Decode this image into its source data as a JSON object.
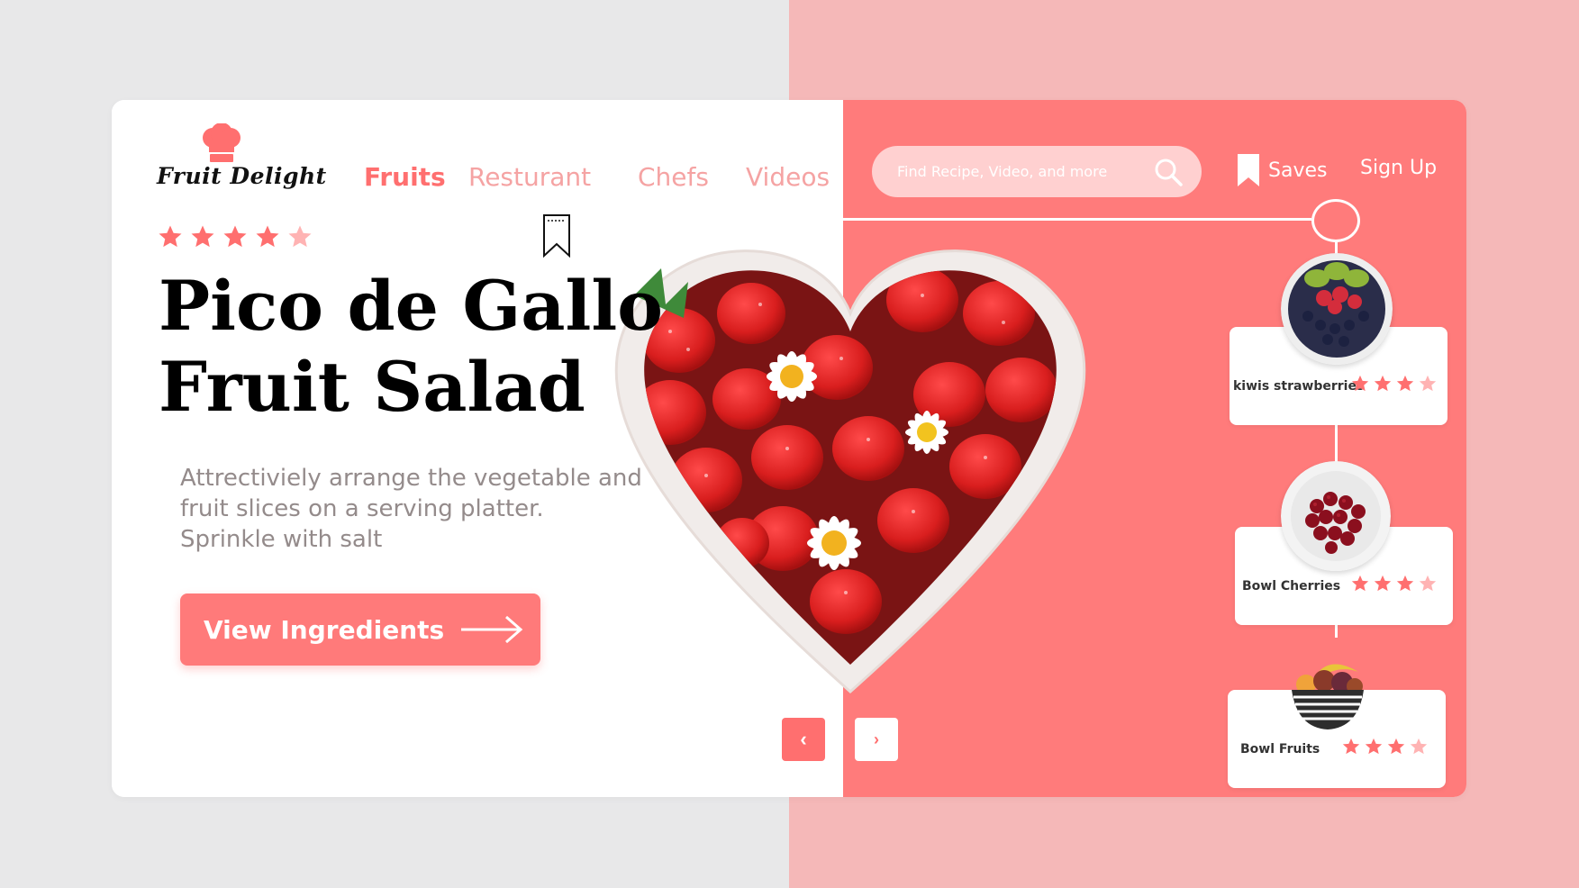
{
  "brand": {
    "name": "Fruit Delight",
    "icon": "chef-hat-icon",
    "color": "#ff6f6f"
  },
  "nav": [
    {
      "label": "Fruits",
      "active": true
    },
    {
      "label": "Resturant",
      "active": false
    },
    {
      "label": "Chefs",
      "active": false
    },
    {
      "label": "Videos",
      "active": false
    }
  ],
  "hero": {
    "rating": 4,
    "rating_max": 5,
    "title_line1": "Pico de Gallo",
    "title_line2": "Fruit Salad",
    "description": [
      "Attrectiviely arrange the vegetable and",
      "fruit slices on a serving platter.",
      "Sprinkle with salt"
    ],
    "cta_label": "View Ingredients"
  },
  "pager": {
    "prev_icon": "chevron-left-icon",
    "next_icon": "chevron-right-icon",
    "prev": "‹",
    "next": "›"
  },
  "search": {
    "placeholder": "Find Recipe, Video, and more",
    "value": ""
  },
  "header_actions": {
    "saves_label": "Saves",
    "signup_label": "Sign Up"
  },
  "recipes": [
    {
      "name": "kiwis strawberries",
      "rating": 3,
      "rating_max": 4
    },
    {
      "name": "Bowl Cherries",
      "rating": 3,
      "rating_max": 4
    },
    {
      "name": "Bowl Fruits",
      "rating": 3,
      "rating_max": 4
    }
  ],
  "colors": {
    "accent": "#ff7b7b",
    "accent_dark": "#ff6f6f",
    "soft": "#f5a3a3",
    "bg_pink": "#f5b8b8",
    "bg_grey": "#e8e8e9"
  }
}
